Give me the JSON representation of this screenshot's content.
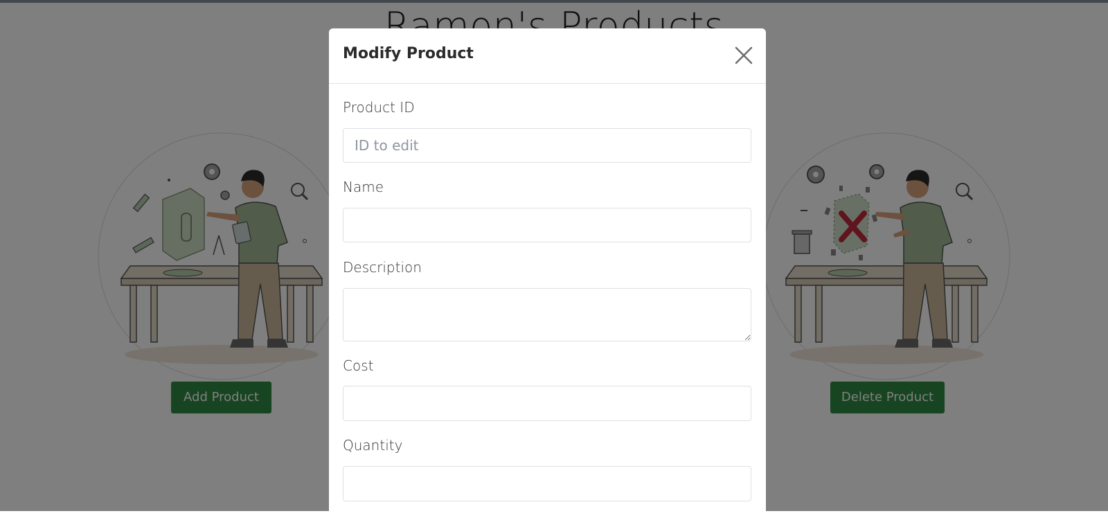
{
  "page": {
    "title": "Ramon's Products"
  },
  "cards": {
    "add": {
      "button_label": "Add Product",
      "illustration_icon": "person-building-product-illustration"
    },
    "delete": {
      "button_label": "Delete Product",
      "illustration_icon": "person-deleting-product-illustration"
    }
  },
  "modal": {
    "title": "Modify Product",
    "close_icon": "close-icon",
    "fields": {
      "product_id": {
        "label": "Product ID",
        "placeholder": "ID to edit",
        "value": ""
      },
      "name": {
        "label": "Name",
        "value": ""
      },
      "description": {
        "label": "Description",
        "value": ""
      },
      "cost": {
        "label": "Cost",
        "value": ""
      },
      "quantity": {
        "label": "Quantity",
        "value": ""
      }
    }
  },
  "colors": {
    "accent_green": "#2f8a42",
    "backdrop": "rgba(0,0,0,0.5)",
    "topbar": "#42464d",
    "illustration_green": "#b7cfae",
    "illustration_table": "#d8cdb8"
  }
}
